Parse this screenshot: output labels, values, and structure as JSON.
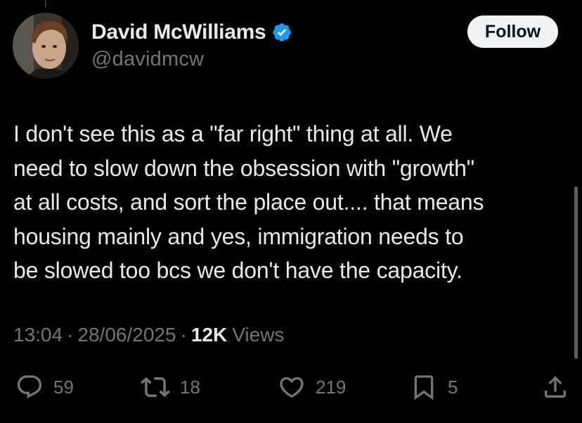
{
  "author": {
    "display_name": "David McWilliams",
    "handle": "@davidmcw",
    "verified": true,
    "verified_color": "#1d9bf0"
  },
  "follow_button": {
    "label": "Follow"
  },
  "tweet": {
    "text": "I don't see this as a \"far right\" thing at all. We\nneed to slow down the obsession with \"growth\"\nat all costs, and sort the place out.... that means\nhousing mainly and yes, immigration needs to\nbe slowed too bcs we don't have the capacity.",
    "time": "13:04",
    "date": "28/06/2025",
    "separator": "·",
    "views_count": "12K",
    "views_label": "Views"
  },
  "actions": {
    "reply": {
      "icon": "reply-icon",
      "count": "59"
    },
    "retweet": {
      "icon": "retweet-icon",
      "count": "18"
    },
    "like": {
      "icon": "heart-icon",
      "count": "219"
    },
    "bookmark": {
      "icon": "bookmark-icon",
      "count": "5"
    },
    "share": {
      "icon": "share-icon"
    }
  },
  "colors": {
    "background": "#000000",
    "primary_text": "#e7e9ea",
    "secondary_text": "#71767b",
    "follow_bg": "#eff3f4"
  }
}
